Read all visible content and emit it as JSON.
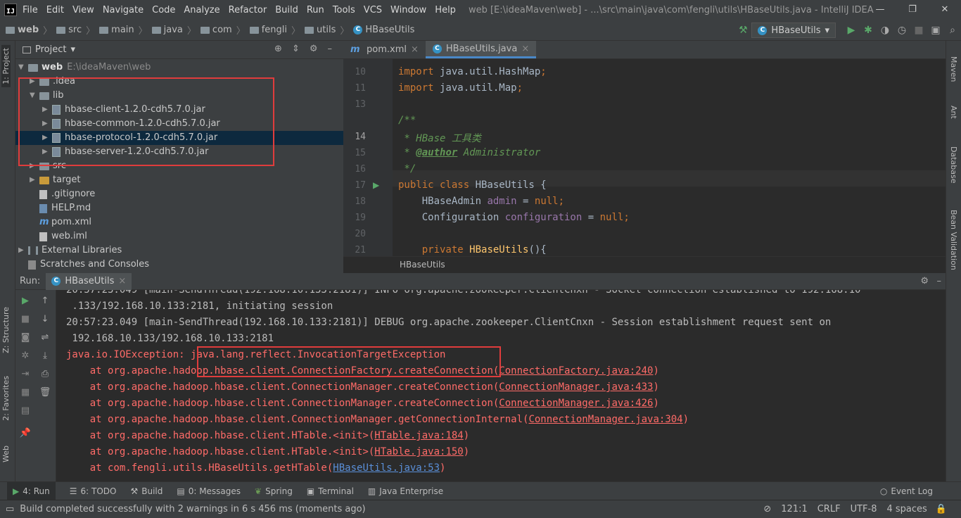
{
  "app": {
    "menus": [
      "File",
      "Edit",
      "View",
      "Navigate",
      "Code",
      "Analyze",
      "Refactor",
      "Build",
      "Run",
      "Tools",
      "VCS",
      "Window",
      "Help"
    ],
    "title": "web [E:\\ideaMaven\\web] - ...\\src\\main\\java\\com\\fengli\\utils\\HBaseUtils.java - IntelliJ IDEA"
  },
  "breadcrumb": [
    "web",
    "src",
    "main",
    "java",
    "com",
    "fengli",
    "utils",
    "HBaseUtils"
  ],
  "run_config": "HBaseUtils",
  "left_strip": {
    "project": "1: Project",
    "structure": "Z: Structure",
    "favorites": "2: Favorites",
    "web": "Web"
  },
  "right_strip": {
    "maven": "Maven",
    "ant": "Ant",
    "database": "Database",
    "bean": "Bean Validation"
  },
  "project": {
    "header": "Project",
    "root": "web",
    "root_path": "E:\\ideaMaven\\web",
    "items": [
      ".idea",
      "lib",
      "hbase-client-1.2.0-cdh5.7.0.jar",
      "hbase-common-1.2.0-cdh5.7.0.jar",
      "hbase-protocol-1.2.0-cdh5.7.0.jar",
      "hbase-server-1.2.0-cdh5.7.0.jar",
      "src",
      "target",
      ".gitignore",
      "HELP.md",
      "pom.xml",
      "web.iml",
      "External Libraries",
      "Scratches and Consoles"
    ]
  },
  "editor": {
    "tabs": [
      "pom.xml",
      "HBaseUtils.java"
    ],
    "line_numbers": [
      "10",
      "11",
      "13",
      "14",
      "15",
      "16",
      "17",
      "18",
      "19",
      "20",
      "21"
    ],
    "crumb": "HBaseUtils",
    "code": {
      "l10a": "import",
      "l10b": " java.util.HashMap",
      "l11a": "import",
      "l11b": " java.util.Map",
      "l14": "/**",
      "l15": " * HBase 工具类",
      "l16a": " * ",
      "l16b": "@author",
      "l16c": " Administrator",
      "l17": " */",
      "l18a": "public class ",
      "l18b": "HBaseUtils {",
      "l19a": "    HBaseAdmin ",
      "l19b": "admin",
      "l19c": " = ",
      "l19d": "null",
      "l20a": "    Configuration ",
      "l20b": "configuration",
      "l20c": " = ",
      "l20d": "null",
      "l21a": "    private ",
      "l21b": "HBaseUtils",
      "l21c": "(){"
    }
  },
  "run": {
    "label": "Run:",
    "tab": "HBaseUtils",
    "lines": {
      "c0": "20:57:23.049 [main-SendThread(192.168.10.133:2181)] INFO org.apache.zookeeper.ClientCnxn - Socket connection established to 192.168.10",
      "c1": " .133/192.168.10.133:2181, initiating session",
      "c2": "20:57:23.049 [main-SendThread(192.168.10.133:2181)] DEBUG org.apache.zookeeper.ClientCnxn - Session establishment request sent on",
      "c3": " 192.168.10.133/192.168.10.133:2181",
      "c4a": "java.io.IOException: ",
      "c4b": "java.lang.reflect.InvocationTargetException",
      "c5a": "    at org.apache.hadoop.hbase.client.ConnectionFactory.createConnection(",
      "c5b": "ConnectionFactory.java:240",
      "c5c": ")",
      "c6a": "    at org.apache.hadoop.hbase.client.ConnectionManager.createConnection(",
      "c6b": "ConnectionManager.java:433",
      "c6c": ")",
      "c7a": "    at org.apache.hadoop.hbase.client.ConnectionManager.createConnection(",
      "c7b": "ConnectionManager.java:426",
      "c7c": ")",
      "c8a": "    at org.apache.hadoop.hbase.client.ConnectionManager.getConnectionInternal(",
      "c8b": "ConnectionManager.java:304",
      "c8c": ")",
      "c9a": "    at org.apache.hadoop.hbase.client.HTable.<init>(",
      "c9b": "HTable.java:184",
      "c9c": ")",
      "c10a": "    at org.apache.hadoop.hbase.client.HTable.<init>(",
      "c10b": "HTable.java:150",
      "c10c": ")",
      "c11a": "    at com.fengli.utils.HBaseUtils.getHTable(",
      "c11b": "HBaseUtils.java:53",
      "c11c": ")"
    }
  },
  "bottom_tabs": [
    "4: Run",
    "6: TODO",
    "Build",
    "0: Messages",
    "Spring",
    "Terminal",
    "Java Enterprise",
    "Event Log"
  ],
  "status": {
    "message": "Build completed successfully with 2 warnings in 6 s 456 ms (moments ago)",
    "position": "121:1",
    "line_sep": "CRLF",
    "encoding": "UTF-8",
    "indent": "4 spaces"
  }
}
